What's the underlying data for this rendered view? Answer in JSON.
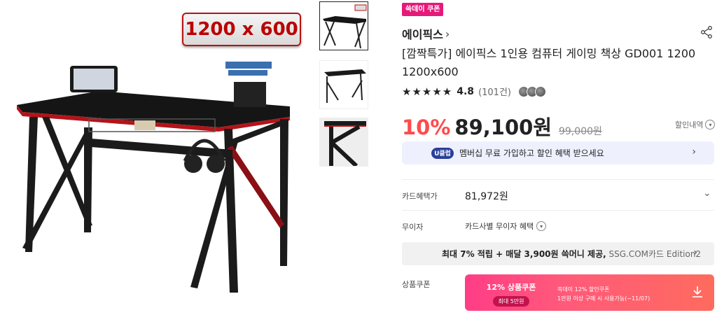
{
  "size_badge": "1200 x 600",
  "coupon_tag": "쓱데이 쿠폰",
  "brand": "에이픽스",
  "title": "[깜짝특가] 에이픽스 1인용 컴퓨터 게이밍 책상 GD001 1200 1200x600",
  "rating": {
    "stars": "★★★★★",
    "score": "4.8",
    "count": "(101건)"
  },
  "price": {
    "discount": "10%",
    "sale": "89,100원",
    "original": "99,000원",
    "history_label": "할인내역"
  },
  "member": {
    "badge": "U클럽",
    "text": "멤버십 무료 가입하고 할인 혜택 받으세요"
  },
  "card": {
    "label": "카드혜택가",
    "price": "81,972원"
  },
  "installment": {
    "label": "무이자",
    "text": "카드사별 무이자 혜택"
  },
  "ssg_bar": {
    "prefix": "최대 7% 적립 + 매달 3,900원 쓱머니 제공,",
    "suffix": " SSG.COM카드 Edition2"
  },
  "coupon": {
    "label": "상품쿠폰",
    "title": "12% 상품쿠폰",
    "cap": "최대 5만원",
    "desc1": "쓱데이 12% 할인쿠폰",
    "desc2": "1만원 이상 구매 시 사용가능(~11/07)"
  },
  "colors": {
    "accent_pink": "#e6197a",
    "discount_red": "#ff4b4b",
    "member_bg": "#eef1fd",
    "uclub_navy": "#2a3f9a"
  }
}
